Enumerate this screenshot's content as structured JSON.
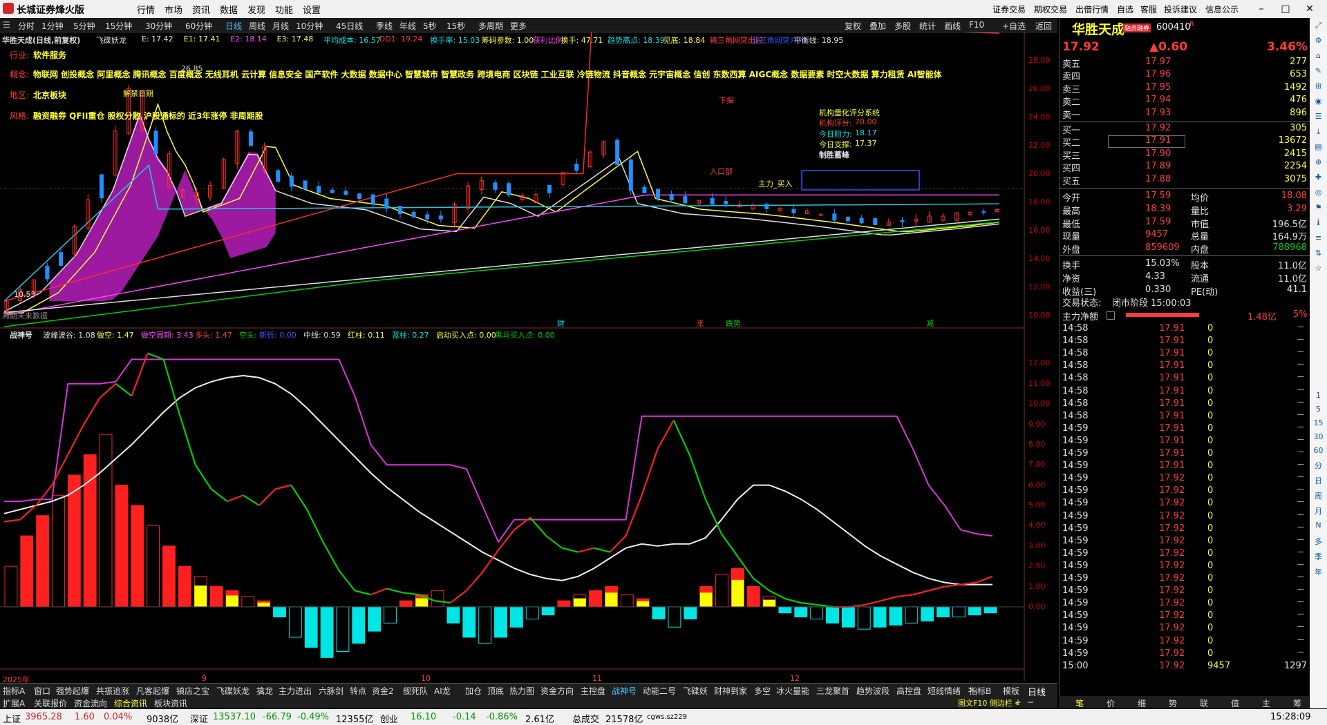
{
  "app": {
    "title": "长城证券烽火版",
    "menus": [
      "行情",
      "市场",
      "资讯",
      "数据",
      "发现",
      "功能",
      "设置"
    ],
    "right_menus": [
      "证券交易",
      "期权交易",
      "出借行情",
      "自选",
      "客服",
      "投诉建议",
      "信息公示"
    ]
  },
  "timeframes": {
    "items": [
      "分时",
      "1分钟",
      "5分钟",
      "15分钟",
      "30分钟",
      "60分钟",
      "日线",
      "周线",
      "月线",
      "10分钟",
      "45日线",
      "季线",
      "年线",
      "5秒",
      "15秒",
      "多周期",
      "更多"
    ],
    "active": "日线",
    "right_items": [
      "复权",
      "叠加",
      "多股",
      "统计",
      "画线",
      "F10",
      "+自选",
      "返回"
    ]
  },
  "main_chart": {
    "stock_title": "华胜天成(日线,前复权)",
    "indicator_name": "飞碟妖龙",
    "indicators": [
      {
        "text": "E: 17.42",
        "color": "#e0e0e0"
      },
      {
        "text": "E1: 17.41",
        "color": "#ffff33"
      },
      {
        "text": "E2: 18.14",
        "color": "#ff44ff"
      },
      {
        "text": "E3: 17.48",
        "color": "#ffff33"
      },
      {
        "text": "平均成本: 16.57",
        "color": "#00e5e5"
      },
      {
        "text": "DD1: 19.24",
        "color": "#ff3b3b"
      },
      {
        "text": "换手率: 15.03",
        "color": "#00e5e5"
      },
      {
        "text": "筹码参数: 1.00",
        "color": "#ffff33"
      },
      {
        "text": "获利比例:",
        "color": "#ff44ff"
      },
      {
        "text": "换手: 47.71",
        "color": "#ffff33"
      },
      {
        "text": "趋势高点: 18.39",
        "color": "#00e5e5"
      },
      {
        "text": "见底: 18.84",
        "color": "#ffff33"
      },
      {
        "text": "输三角网突出段:",
        "color": "#ff3b3b"
      },
      {
        "text": "蓝三角网突介入:",
        "color": "#3355ff"
      },
      {
        "text": "平衡线: 18.95",
        "color": "#e0e0e0"
      }
    ],
    "info_lines": [
      {
        "label": "行业:",
        "value": "软件服务"
      },
      {
        "label": "概念:",
        "value": "物联网 创投概念 阿里概念 腾讯概念 百度概念 无线耳机 云计算 信息安全 国产软件 大数据 数据中心 智慧城市 智慧政务 跨境电商 区块链 工业互联 冷链物流 抖音概念 元宇宙概念 信创 东数西算 AIGC概念 数据要素 时空大数据 算力租赁 AI智能体"
      },
      {
        "label": "地区:",
        "value": "北京板块"
      },
      {
        "label": "风格:",
        "value": "融资融券 QFII重仓 股权分散 沪股通标的 近3年涨停 非周期股"
      }
    ],
    "annotations": {
      "peak_price": "26.85",
      "low_price": "10.53",
      "jiedong": "解禁日期",
      "xiaxie": "下探",
      "zhuli": "主力_买入",
      "rukou": "入口部",
      "bottom_label": "周期未来数据"
    },
    "quant_box": {
      "title": "机构量化评分系统",
      "score_label": "机构评分:",
      "score": "70.00",
      "resist_label": "今日阻力:",
      "resist": "18.17",
      "support_label": "今日支撑:",
      "support": "17.37",
      "verdict": "制胜蓄峰"
    },
    "event_labels": [
      "财",
      "涨",
      "跌势",
      "减"
    ],
    "y_axis": [
      "28.00",
      "26.00",
      "24.00",
      "22.00",
      "20.00",
      "18.00",
      "16.00",
      "14.00",
      "12.00",
      "10.00"
    ]
  },
  "sub_chart": {
    "name": "战神号",
    "indicators": [
      {
        "text": "波峰波谷: 1.08",
        "color": "#e0e0e0"
      },
      {
        "text": "做空: 1.47",
        "color": "#ffff33"
      },
      {
        "text": "做空周期: 3.43",
        "color": "#ff44ff"
      },
      {
        "text": "多头: 1.47",
        "color": "#ff3b3b"
      },
      {
        "text": "空头:",
        "color": "#00d000"
      },
      {
        "text": "新低: 0.00",
        "color": "#3355ff"
      },
      {
        "text": "中线: 0.59",
        "color": "#e0e0e0"
      },
      {
        "text": "红柱: 0.11",
        "color": "#ffff33"
      },
      {
        "text": "蓝柱: 0.27",
        "color": "#00e5e5"
      },
      {
        "text": "启动买入点: 0.00",
        "color": "#ffff33"
      },
      {
        "text": "黑马买入点: 0.00",
        "color": "#00d000"
      }
    ],
    "y_axis": [
      "12.00",
      "11.00",
      "10.00",
      "9.00",
      "8.00",
      "7.00",
      "6.00",
      "5.00",
      "4.00",
      "3.00",
      "2.00",
      "1.00",
      "0.00"
    ]
  },
  "x_axis": [
    "2025年",
    "9",
    "10",
    "11",
    "12"
  ],
  "bottom_tabs": [
    "指标A",
    "窗口",
    "强势起爆",
    "共振追涨",
    "凡客起爆",
    "镇店之宝",
    "飞碟妖龙",
    "擒龙",
    "主力进出",
    "六脉剑",
    "转点",
    "资金2",
    "舰死队",
    "AI龙",
    "加仓",
    "顶底",
    "热力图",
    "资金方向",
    "主控盘",
    "战神号",
    "动能二号",
    "飞碟妖",
    "财神到家",
    "多空",
    "冰火量能",
    "三龙聚首",
    "趋势波段",
    "高控盘",
    "短线情绪"
  ],
  "bottom_tabs_active": "战神号",
  "bottom_tabs_right": [
    "指标B",
    "模板",
    "日线"
  ],
  "bottom_tabs2": [
    "扩展A",
    "关联报价",
    "资金流向",
    "综合资讯",
    "板块资讯"
  ],
  "quote": {
    "name": "华胜天成",
    "tag": "融资融券",
    "code": "600410",
    "price": "17.92",
    "change": "▲0.60",
    "pct": "3.46%",
    "asks": [
      {
        "label": "卖五",
        "price": "17.97",
        "vol": "277"
      },
      {
        "label": "卖四",
        "price": "17.96",
        "vol": "653"
      },
      {
        "label": "卖三",
        "price": "17.95",
        "vol": "1492"
      },
      {
        "label": "卖二",
        "price": "17.94",
        "vol": "476"
      },
      {
        "label": "卖一",
        "price": "17.93",
        "vol": "896"
      }
    ],
    "bids": [
      {
        "label": "买一",
        "price": "17.92",
        "vol": "305"
      },
      {
        "label": "买二",
        "price": "17.91",
        "vol": "13672"
      },
      {
        "label": "买三",
        "price": "17.90",
        "vol": "2415"
      },
      {
        "label": "买四",
        "price": "17.89",
        "vol": "2254"
      },
      {
        "label": "买五",
        "price": "17.88",
        "vol": "3075"
      }
    ],
    "stats": [
      {
        "l1": "今开",
        "v1": "17.59",
        "c1": "#ff3b3b",
        "l2": "均价",
        "v2": "18.08",
        "c2": "#ff3b3b"
      },
      {
        "l1": "最高",
        "v1": "18.39",
        "c1": "#ff3b3b",
        "l2": "量比",
        "v2": "3.29",
        "c2": "#ff3b3b"
      },
      {
        "l1": "最低",
        "v1": "17.59",
        "c1": "#ff3b3b",
        "l2": "市值",
        "v2": "196.5亿",
        "c2": "#e0e0e0"
      },
      {
        "l1": "现量",
        "v1": "9457",
        "c1": "#ff3b3b",
        "l2": "总量",
        "v2": "164.9万",
        "c2": "#e0e0e0"
      },
      {
        "l1": "外盘",
        "v1": "859609",
        "c1": "#ff3b3b",
        "l2": "内盘",
        "v2": "788968",
        "c2": "#00d000"
      },
      {
        "l1": "换手",
        "v1": "15.03%",
        "c1": "#e0e0e0",
        "l2": "股本",
        "v2": "11.0亿",
        "c2": "#e0e0e0"
      },
      {
        "l1": "净资",
        "v1": "4.33",
        "c1": "#e0e0e0",
        "l2": "流通",
        "v2": "11.0亿",
        "c2": "#e0e0e0"
      },
      {
        "l1": "收益(三)",
        "v1": "0.330",
        "c1": "#e0e0e0",
        "l2": "PE(动)",
        "v2": "41.1",
        "c2": "#e0e0e0"
      }
    ],
    "trade_status_label": "交易状态:",
    "trade_status": "闭市阶段 15:00:03",
    "net_label": "主力净额",
    "net_value": "1.48亿",
    "net_pct": "5%",
    "ticks": [
      {
        "t": "14:58",
        "p": "17.91",
        "v": "0"
      },
      {
        "t": "14:58",
        "p": "17.91",
        "v": "0"
      },
      {
        "t": "14:58",
        "p": "17.91",
        "v": "0"
      },
      {
        "t": "14:58",
        "p": "17.91",
        "v": "0"
      },
      {
        "t": "14:58",
        "p": "17.91",
        "v": "0"
      },
      {
        "t": "14:58",
        "p": "17.91",
        "v": "0"
      },
      {
        "t": "14:58",
        "p": "17.91",
        "v": "0"
      },
      {
        "t": "14:58",
        "p": "17.91",
        "v": "0"
      },
      {
        "t": "14:59",
        "p": "17.91",
        "v": "0"
      },
      {
        "t": "14:59",
        "p": "17.91",
        "v": "0"
      },
      {
        "t": "14:59",
        "p": "17.91",
        "v": "0"
      },
      {
        "t": "14:59",
        "p": "17.91",
        "v": "0"
      },
      {
        "t": "14:59",
        "p": "17.92",
        "v": "0"
      },
      {
        "t": "14:59",
        "p": "17.92",
        "v": "0"
      },
      {
        "t": "14:59",
        "p": "17.92",
        "v": "0"
      },
      {
        "t": "14:59",
        "p": "17.92",
        "v": "0"
      },
      {
        "t": "14:59",
        "p": "17.92",
        "v": "0"
      },
      {
        "t": "14:59",
        "p": "17.92",
        "v": "0"
      },
      {
        "t": "14:59",
        "p": "17.92",
        "v": "0"
      },
      {
        "t": "14:59",
        "p": "17.92",
        "v": "0"
      },
      {
        "t": "14:59",
        "p": "17.92",
        "v": "0"
      },
      {
        "t": "14:59",
        "p": "17.92",
        "v": "0"
      },
      {
        "t": "14:59",
        "p": "17.92",
        "v": "0"
      },
      {
        "t": "14:59",
        "p": "17.92",
        "v": "0"
      },
      {
        "t": "14:59",
        "p": "17.92",
        "v": "0"
      },
      {
        "t": "14:59",
        "p": "17.92",
        "v": "0"
      },
      {
        "t": "14:59",
        "p": "17.92",
        "v": "0"
      },
      {
        "t": "15:00",
        "p": "17.92",
        "v": "9457",
        "n": "1297"
      }
    ],
    "f10_link": "图文F10 侧边栏 «",
    "right_tabs": [
      "笔",
      "价",
      "细",
      "势",
      "联",
      "值",
      "主",
      "筹"
    ]
  },
  "sidebar": [
    "分",
    "日",
    "周",
    "月",
    "N",
    "多",
    "季",
    "年"
  ],
  "statusbar": {
    "sh_label": "上证",
    "sh_val": "3965.28",
    "sh_chg": "1.60",
    "sh_pct": "0.04%",
    "sh_amt": "9038亿",
    "sz_label": "深证",
    "sz_val": "13537.10",
    "sz_chg": "-66.79",
    "sz_pct": "-0.49%",
    "sz_amt": "12355亿",
    "cy_label": "创业",
    "cy_val": "16.10",
    "cy_chg": "-0.14",
    "cy_pct": "-0.86%",
    "cy_amt": "2.61亿",
    "total_label": "总成交",
    "total_val": "21578亿",
    "server": "cgws.sz229",
    "time": "15:28:09"
  },
  "chart_data": {
    "type": "candlestick",
    "price_range": [
      9.5,
      29
    ],
    "sub_range": [
      -3,
      13
    ],
    "sub_series": {
      "white": [
        4.6,
        4.8,
        5.0,
        5.2,
        5.5,
        6.0,
        6.6,
        7.3,
        8.0,
        8.8,
        9.6,
        10.3,
        10.8,
        11.1,
        11.3,
        11.4,
        11.3,
        11.0,
        10.5,
        9.8,
        9.0,
        8.2,
        7.4,
        6.6,
        5.9,
        5.3,
        4.7,
        4.2,
        3.7,
        3.2,
        2.7,
        2.3,
        1.9,
        1.6,
        1.4,
        1.3,
        1.5,
        1.9,
        2.4,
        2.9,
        3.1,
        3.0,
        3.1,
        3.1,
        3.4,
        4.3,
        5.3,
        6.0,
        6.0,
        5.7,
        5.3,
        4.8,
        4.2,
        3.6,
        3.0,
        2.5,
        2.1,
        1.7,
        1.4,
        1.2,
        1.1,
        1.1,
        1.1
      ],
      "line": [
        4.2,
        4.3,
        5.0,
        6.0,
        7.5,
        9.0,
        10.3,
        11.0,
        10.4,
        12.5,
        12.2,
        9.5,
        7.0,
        5.8,
        5.2,
        5.5,
        5.0,
        5.8,
        6.0,
        4.8,
        3.2,
        1.8,
        0.8,
        0.6,
        0.9,
        0.7,
        0.6,
        0.3,
        0.2,
        0.8,
        1.7,
        2.8,
        3.8,
        4.4,
        3.5,
        2.9,
        2.7,
        2.9,
        2.7,
        3.5,
        5.5,
        7.8,
        9.2,
        7.5,
        5.3,
        3.6,
        2.5,
        1.4,
        0.8,
        0.4,
        0.2,
        0.1,
        0.0,
        0.0,
        0.1,
        0.3,
        0.5,
        0.6,
        0.8,
        1.0,
        1.1,
        1.2,
        1.5
      ],
      "magenta": [
        5.2,
        5.2,
        5.3,
        5.3,
        11.0,
        11.0,
        11.0,
        11.1,
        12.2,
        12.2,
        12.2,
        12.2,
        12.2,
        12.2,
        12.2,
        12.2,
        12.2,
        12.2,
        12.2,
        12.2,
        12.2,
        12.2,
        10.4,
        8.0,
        7.0,
        7.0,
        7.0,
        7.0,
        7.0,
        6.8,
        5.0,
        3.2,
        4.3,
        4.3,
        4.3,
        4.3,
        4.3,
        4.3,
        4.3,
        4.3,
        9.4,
        9.4,
        9.4,
        9.4,
        9.4,
        9.4,
        9.4,
        9.4,
        9.4,
        9.4,
        9.4,
        9.4,
        9.4,
        9.4,
        9.4,
        9.4,
        9.4,
        7.8,
        6.0,
        5.0,
        3.8,
        3.6,
        3.5
      ]
    },
    "volume_bars": [
      2.0,
      3.5,
      4.5,
      5.5,
      6.5,
      7.5,
      8.5,
      6.0,
      5.0,
      4.0,
      3.0,
      2.0,
      1.5,
      1.0,
      0.8,
      0.5,
      0.3,
      -0.5,
      -1.5,
      -2.0,
      -2.5,
      -2.2,
      -1.8,
      -1.2,
      -0.8,
      0.3,
      0.6,
      0.8,
      -0.8,
      -1.5,
      -1.8,
      -1.5,
      -1.0,
      -0.6,
      -0.4,
      0.3,
      0.6,
      0.8,
      1.0,
      0.6,
      0.4,
      -0.6,
      -1.0,
      -0.6,
      1.0,
      1.6,
      1.9,
      1.0,
      0.5,
      -0.3,
      -0.5,
      -0.6,
      -0.8,
      -1.0,
      -1.1,
      -1.0,
      -0.9,
      -0.8,
      -0.7,
      -0.5,
      -0.5,
      -0.4,
      -0.3
    ]
  }
}
